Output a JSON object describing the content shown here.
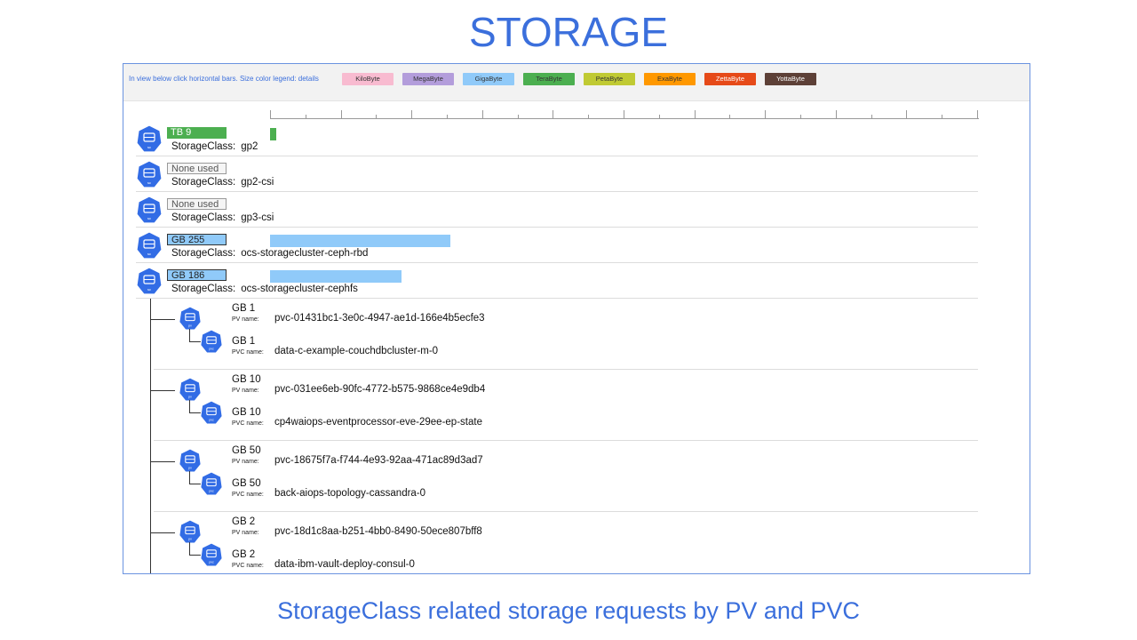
{
  "page": {
    "title": "STORAGE",
    "subtitle": "StorageClass related storage requests by PV and PVC"
  },
  "legend": {
    "note": "In view below click horizontal bars. Size color legend: details",
    "items": [
      {
        "label": "KiloByte",
        "color": "#f8bbd0"
      },
      {
        "label": "MegaByte",
        "color": "#b39ddb"
      },
      {
        "label": "GigaByte",
        "color": "#90caf9"
      },
      {
        "label": "TeraByte",
        "color": "#4caf50"
      },
      {
        "label": "PetaByte",
        "color": "#c0ca33"
      },
      {
        "label": "ExaByte",
        "color": "#ff9800"
      },
      {
        "label": "ZettaByte",
        "color": "#e64a19"
      },
      {
        "label": "YottaByte",
        "color": "#5d4037"
      }
    ]
  },
  "storage_label": "StorageClass:",
  "storage_classes": [
    {
      "size": "TB 9",
      "name": "gp2",
      "unit": "tb",
      "fill": 0.009
    },
    {
      "size": "None used",
      "name": "gp2-csi",
      "unit": "none",
      "fill": 0
    },
    {
      "size": "None used",
      "name": "gp3-csi",
      "unit": "none",
      "fill": 0
    },
    {
      "size": "GB 255",
      "name": "ocs-storagecluster-ceph-rbd",
      "unit": "gb",
      "fill": 0.255
    },
    {
      "size": "GB 186",
      "name": "ocs-storagecluster-cephfs",
      "unit": "gb",
      "fill": 0.186
    }
  ],
  "pv_label": "PV name:",
  "pvc_label": "PVC name:",
  "volumes": [
    {
      "pv_size": "GB 1",
      "pv_name": "pvc-01431bc1-3e0c-4947-ae1d-166e4b5ecfe3",
      "pvc_size": "GB 1",
      "pvc_name": "data-c-example-couchdbcluster-m-0"
    },
    {
      "pv_size": "GB 10",
      "pv_name": "pvc-031ee6eb-90fc-4772-b575-9868ce4e9db4",
      "pvc_size": "GB 10",
      "pvc_name": "cp4waiops-eventprocessor-eve-29ee-ep-state"
    },
    {
      "pv_size": "GB 50",
      "pv_name": "pvc-18675f7a-f744-4e93-92aa-471ac89d3ad7",
      "pvc_size": "GB 50",
      "pvc_name": "back-aiops-topology-cassandra-0"
    },
    {
      "pv_size": "GB 2",
      "pv_name": "pvc-18d1c8aa-b251-4bb0-8490-50ece807bff8",
      "pvc_size": "GB 2",
      "pvc_name": "data-ibm-vault-deploy-consul-0"
    }
  ],
  "icons": {
    "storage_class": "storage-class-icon",
    "pv": "persistent-volume-icon",
    "pvc": "persistent-volume-claim-icon",
    "icon_color": "#326ce5"
  }
}
